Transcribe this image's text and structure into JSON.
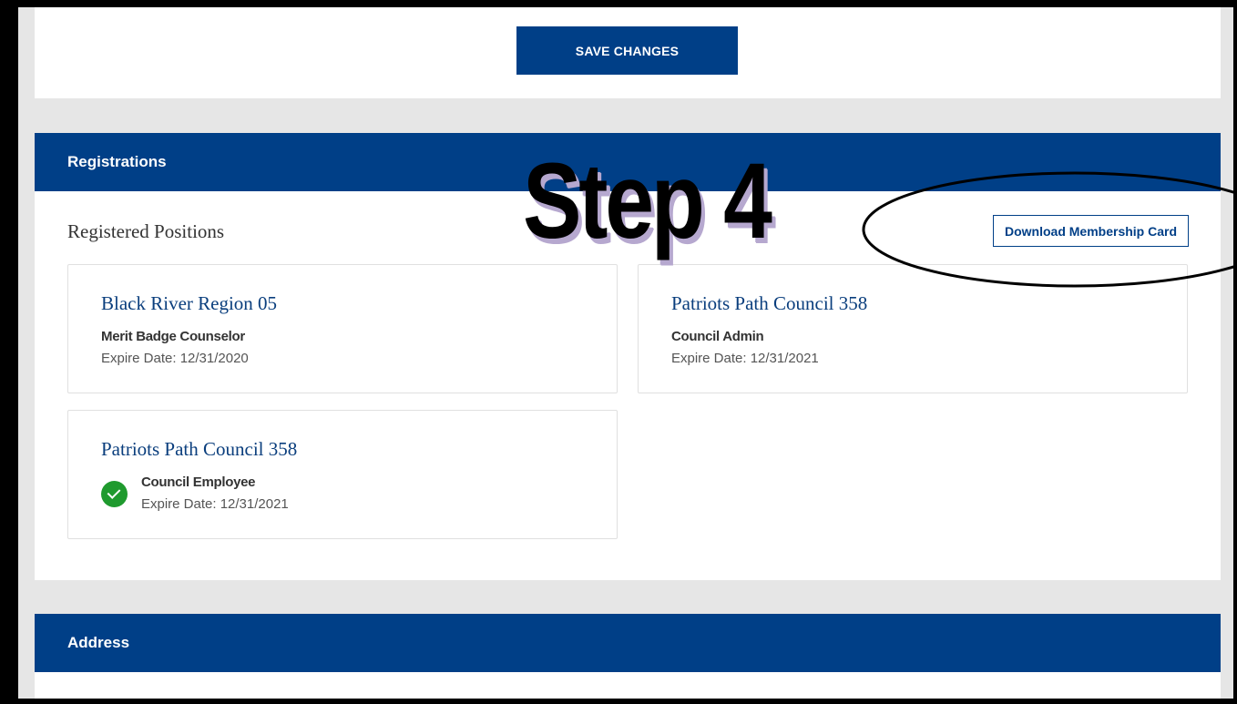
{
  "top_panel": {
    "save_label": "SAVE CHANGES"
  },
  "registrations": {
    "header": "Registrations",
    "title": "Registered Positions",
    "download_label": "Download Membership Card",
    "cards": [
      {
        "title": "Black River Region 05",
        "role": "Merit Badge Counselor",
        "expire": "Expire Date: 12/31/2020"
      },
      {
        "title": "Patriots Path Council 358",
        "role": "Council Admin",
        "expire": "Expire Date: 12/31/2021"
      },
      {
        "title": "Patriots Path Council 358",
        "role": "Council Employee",
        "expire": "Expire Date: 12/31/2021",
        "icon": "check-circle-icon"
      }
    ]
  },
  "address": {
    "header": "Address"
  },
  "annotation": {
    "step_text": "Step 4"
  },
  "colors": {
    "brand_blue": "#003f87",
    "success_green": "#1f9a2e",
    "shadow_lavender": "#b6a8cf"
  }
}
